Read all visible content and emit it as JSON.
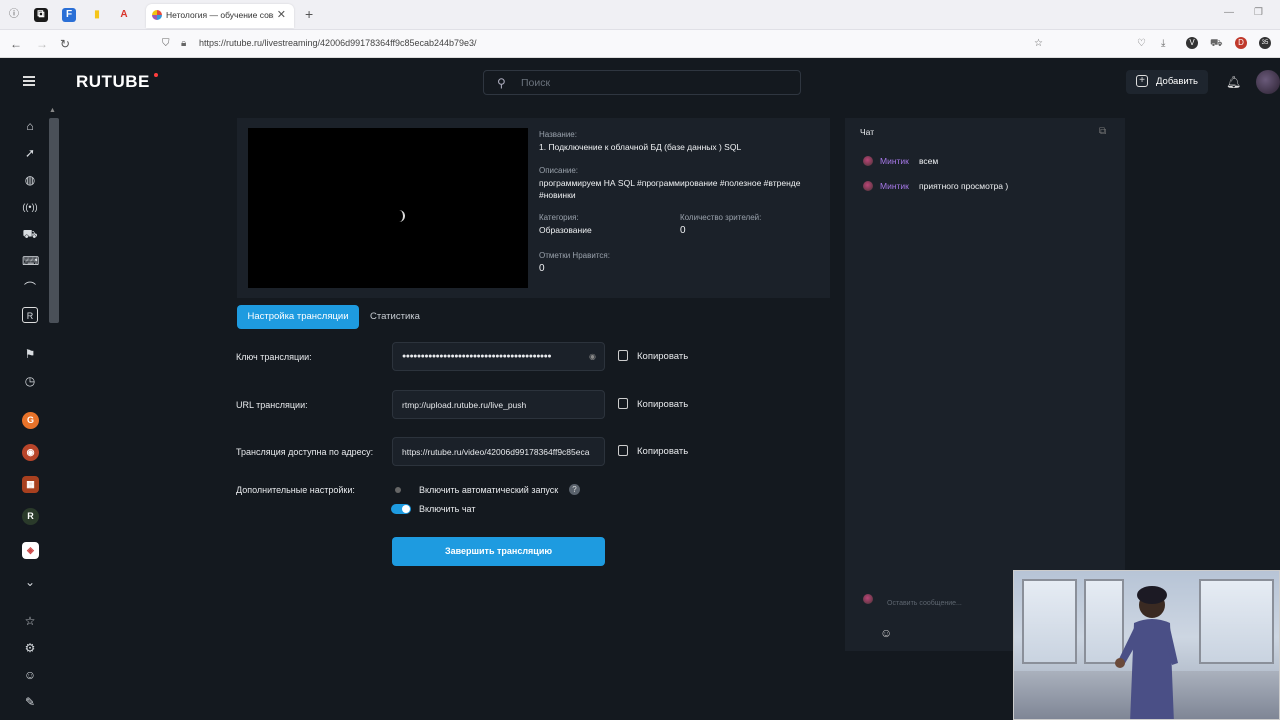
{
  "browser": {
    "tab_title": "Нетология — обучение совр",
    "url": "https://rutube.ru/livestreaming/42006d99178364ff9c85ecab244b79e3/",
    "ext_badge": "35"
  },
  "header": {
    "logo": "RUTUBE",
    "search_placeholder": "Поиск",
    "add_label": "Добавить"
  },
  "stream_info": {
    "title_label": "Название:",
    "title_value": "1. Подключение к облачной БД (базе данных ) SQL",
    "desc_label": "Описание:",
    "desc_value": "программируем НА SQL #программирование #полезное #втренде #новинки",
    "category_label": "Категория:",
    "category_value": "Образование",
    "viewers_label": "Количество зрителей:",
    "viewers_value": "0",
    "likes_label": "Отметки Нравится:",
    "likes_value": "0"
  },
  "tabs": {
    "settings": "Настройка трансляции",
    "stats": "Статистика"
  },
  "form": {
    "key_label": "Ключ трансляции:",
    "key_value": "●●●●●●●●●●●●●●●●●●●●●●●●●●●●●●●●●●●●●●●●",
    "url_label": "URL трансляции:",
    "url_value": "rtmp://upload.rutube.ru/live_push",
    "address_label": "Трансляция доступна по адресу:",
    "address_value": "https://rutube.ru/video/42006d99178364ff9c85eca",
    "copy_label": "Копировать",
    "extra_label": "Дополнительные настройки:",
    "autostart_label": "Включить автоматический запуск",
    "chat_toggle_label": "Включить чат",
    "end_button": "Завершить трансляцию"
  },
  "chat": {
    "title": "Чат",
    "messages": [
      {
        "user": "Минтик",
        "text": "всем"
      },
      {
        "user": "Минтик",
        "text": "приятного просмотра )"
      }
    ],
    "input_placeholder": "Оставить сообщение..."
  },
  "colors": {
    "accent": "#1e9be0",
    "background": "#14191f",
    "panel": "#1b2129",
    "chat_user": "#a678e8"
  }
}
